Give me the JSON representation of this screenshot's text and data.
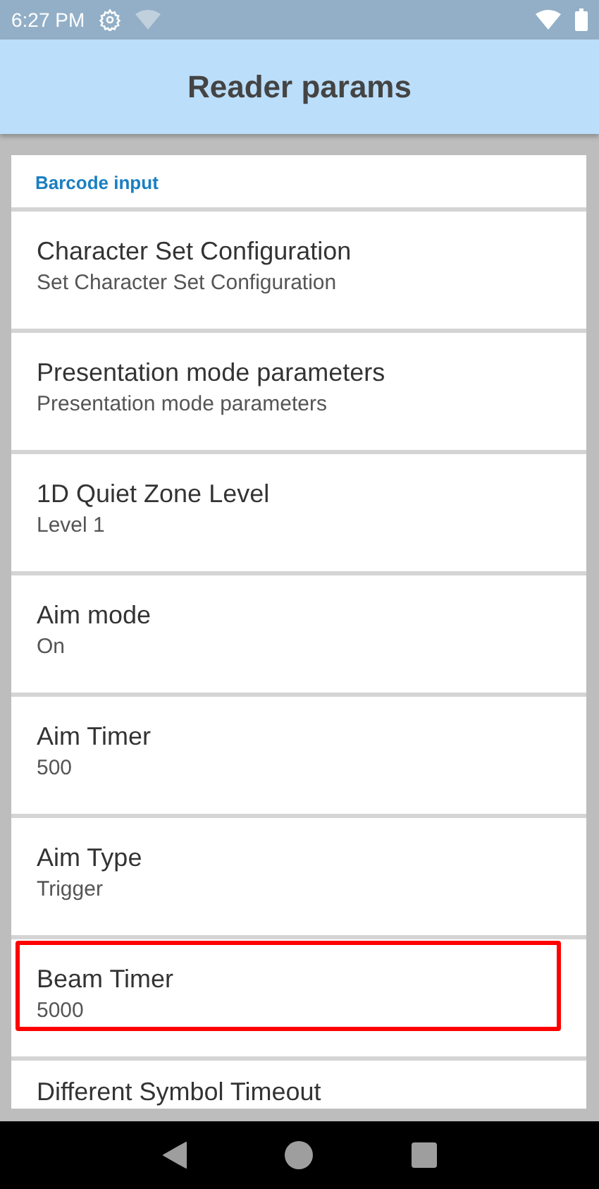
{
  "status_bar": {
    "time": "6:27 PM"
  },
  "header": {
    "title": "Reader params"
  },
  "section": {
    "title": "Barcode input"
  },
  "items": [
    {
      "title": "Character Set Configuration",
      "summary": "Set Character Set Configuration",
      "highlighted": false
    },
    {
      "title": "Presentation mode parameters",
      "summary": "Presentation mode parameters",
      "highlighted": false
    },
    {
      "title": "1D Quiet Zone Level",
      "summary": "Level 1",
      "highlighted": false
    },
    {
      "title": "Aim mode",
      "summary": "On",
      "highlighted": false
    },
    {
      "title": "Aim Timer",
      "summary": "500",
      "highlighted": false
    },
    {
      "title": "Aim Type",
      "summary": "Trigger",
      "highlighted": false
    },
    {
      "title": "Beam Timer",
      "summary": "5000",
      "highlighted": true
    },
    {
      "title": "Different Symbol Timeout",
      "highlighted": false
    }
  ]
}
